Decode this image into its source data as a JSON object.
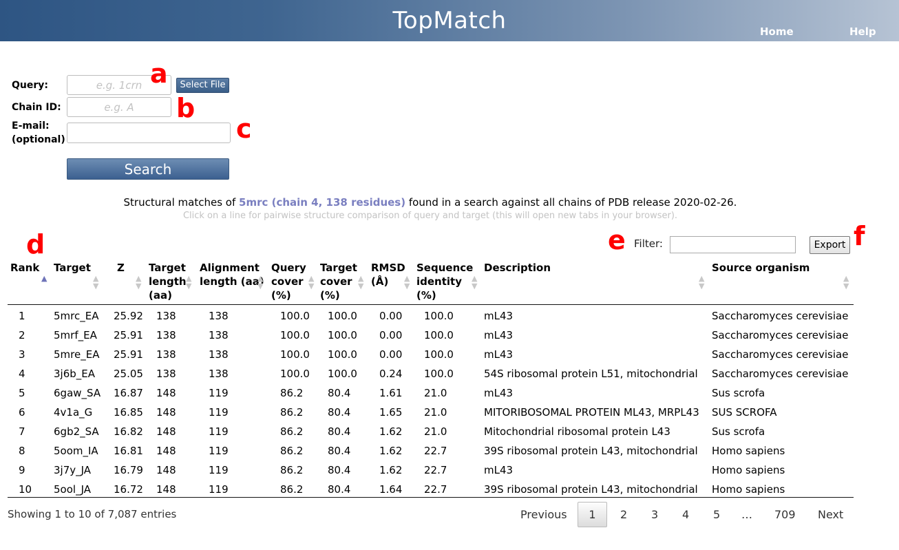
{
  "header": {
    "title": "TopMatch",
    "nav": {
      "home": "Home",
      "help": "Help"
    }
  },
  "form": {
    "query_label": "Query:",
    "query_placeholder": "e.g. 1crn",
    "select_file": "Select File",
    "chain_label": "Chain ID:",
    "chain_placeholder": "e.g. A",
    "email_label_1": "E-mail:",
    "email_label_2": "(optional)",
    "search": "Search"
  },
  "annotations": {
    "a": "a",
    "b": "b",
    "c": "c",
    "d": "d",
    "e": "e",
    "f": "f"
  },
  "info": {
    "prefix": "Structural matches of ",
    "highlight": "5mrc (chain 4, 138 residues)",
    "suffix": " found in a search against all chains of PDB release 2020-02-26.",
    "sub": "Click on a line for pairwise structure comparison of query and target (this will open new tabs in your browser)."
  },
  "filter": {
    "label": "Filter:",
    "value": ""
  },
  "export": "Export",
  "table": {
    "headers": [
      [
        "Rank"
      ],
      [
        "Target"
      ],
      [
        "Z"
      ],
      [
        "Target",
        "length",
        "(aa)"
      ],
      [
        "Alignment",
        "length (aa)"
      ],
      [
        "Query",
        "cover",
        "(%)"
      ],
      [
        "Target",
        "cover",
        "(%)"
      ],
      [
        "RMSD",
        "(Å)"
      ],
      [
        "Sequence",
        "identity",
        "(%)"
      ],
      [
        "Description"
      ],
      [
        "Source organism"
      ]
    ],
    "rows": [
      [
        "1",
        "5mrc_EA",
        "25.92",
        "138",
        "138",
        "100.0",
        "100.0",
        "0.00",
        "100.0",
        "mL43",
        "Saccharomyces cerevisiae"
      ],
      [
        "2",
        "5mrf_EA",
        "25.91",
        "138",
        "138",
        "100.0",
        "100.0",
        "0.00",
        "100.0",
        "mL43",
        "Saccharomyces cerevisiae"
      ],
      [
        "3",
        "5mre_EA",
        "25.91",
        "138",
        "138",
        "100.0",
        "100.0",
        "0.00",
        "100.0",
        "mL43",
        "Saccharomyces cerevisiae"
      ],
      [
        "4",
        "3j6b_EA",
        "25.05",
        "138",
        "138",
        "100.0",
        "100.0",
        "0.24",
        "100.0",
        "54S ribosomal protein L51, mitochondrial",
        "Saccharomyces cerevisiae"
      ],
      [
        "5",
        "6gaw_SA",
        "16.87",
        "148",
        "119",
        "86.2",
        "80.4",
        "1.61",
        "21.0",
        "mL43",
        "Sus scrofa"
      ],
      [
        "6",
        "4v1a_G",
        "16.85",
        "148",
        "119",
        "86.2",
        "80.4",
        "1.65",
        "21.0",
        "MITORIBOSOMAL PROTEIN ML43, MRPL43",
        "SUS SCROFA"
      ],
      [
        "7",
        "6gb2_SA",
        "16.82",
        "148",
        "119",
        "86.2",
        "80.4",
        "1.62",
        "21.0",
        "Mitochondrial ribosomal protein L43",
        "Sus scrofa"
      ],
      [
        "8",
        "5oom_IA",
        "16.81",
        "148",
        "119",
        "86.2",
        "80.4",
        "1.62",
        "22.7",
        "39S ribosomal protein L43, mitochondrial",
        "Homo sapiens"
      ],
      [
        "9",
        "3j7y_JA",
        "16.79",
        "148",
        "119",
        "86.2",
        "80.4",
        "1.62",
        "22.7",
        "mL43",
        "Homo sapiens"
      ],
      [
        "10",
        "5ool_JA",
        "16.72",
        "148",
        "119",
        "86.2",
        "80.4",
        "1.64",
        "22.7",
        "39S ribosomal protein L43, mitochondrial",
        "Homo sapiens"
      ]
    ]
  },
  "pagination": {
    "showing": "Showing 1 to 10 of 7,087 entries",
    "previous": "Previous",
    "pages": [
      "1",
      "2",
      "3",
      "4",
      "5",
      "…",
      "709"
    ],
    "next": "Next"
  },
  "colors": {
    "header_dark": "#2e5583",
    "header_light": "#b6c3d4",
    "annotation": "#ff0000",
    "highlight": "#7a7fc0"
  }
}
